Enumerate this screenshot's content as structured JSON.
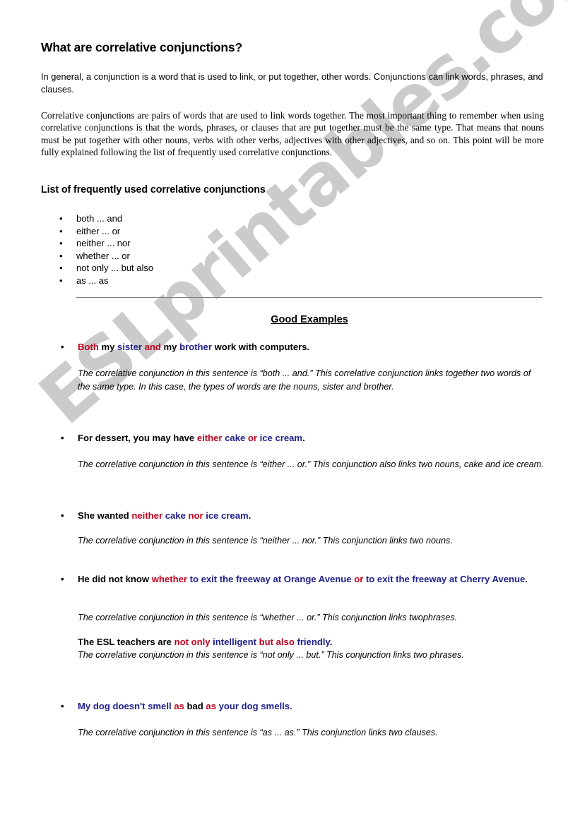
{
  "document": {
    "title": "What are correlative conjunctions?",
    "intro_paragraph": "In general, a conjunction is a word that is used to link, or put together, other words.  Conjunctions can link words, phrases, and clauses.",
    "definition_paragraph": "Correlative conjunctions are pairs of words that are used to link words together.  The most important thing to remember when using correlative conjunctions is that the words, phrases, or clauses that are put together must be the same type.  That means that nouns must be put together with other nouns, verbs with other verbs, adjectives with other adjectives, and so on.  This point will be more fully explained following the list of frequently used correlative conjunctions.",
    "list_heading": "List of frequently used correlative conjunctions",
    "conjunction_list": [
      "both ... and",
      "either ... or",
      "neither ... nor",
      "whether ... or",
      "not only ... but also",
      "as ... as"
    ],
    "examples_heading": "Good Examples",
    "bullet_glyph": "•",
    "examples": [
      {
        "sentence_parts": [
          {
            "text": "Both",
            "color": "red"
          },
          {
            "text": " my ",
            "color": "black"
          },
          {
            "text": "sister",
            "color": "blue"
          },
          {
            "text": " ",
            "color": "black"
          },
          {
            "text": "and",
            "color": "red"
          },
          {
            "text": " my ",
            "color": "black"
          },
          {
            "text": "brother",
            "color": "blue"
          },
          {
            "text": " work with computers.",
            "color": "black"
          }
        ],
        "explanation": "The correlative conjunction in this sentence is “both ... and.”  This correlative conjunction links together two words of the same type.  In this case, the types of words are the nouns, sister and brother."
      },
      {
        "sentence_parts": [
          {
            "text": "For dessert, you may have ",
            "color": "black"
          },
          {
            "text": "either",
            "color": "red"
          },
          {
            "text": " cake ",
            "color": "blue"
          },
          {
            "text": "or",
            "color": "red"
          },
          {
            "text": " ice cream",
            "color": "blue"
          },
          {
            "text": ".",
            "color": "black"
          }
        ],
        "explanation": "The correlative conjunction in this sentence is “either ... or.”  This conjunction also links two nouns, cake and ice cream."
      },
      {
        "sentence_parts": [
          {
            "text": "She wanted ",
            "color": "black"
          },
          {
            "text": "neither",
            "color": "red"
          },
          {
            "text": " cake ",
            "color": "blue"
          },
          {
            "text": "nor",
            "color": "red"
          },
          {
            "text": " ice cream",
            "color": "blue"
          },
          {
            "text": ".",
            "color": "black"
          }
        ],
        "explanation": "The correlative conjunction in this sentence is “neither ... nor.”  This conjunction links two nouns."
      },
      {
        "sentence_parts": [
          {
            "text": "He did not know ",
            "color": "black"
          },
          {
            "text": "whether",
            "color": "red"
          },
          {
            "text": " to exit the freeway at Orange Avenue ",
            "color": "blue"
          },
          {
            "text": "or",
            "color": "red"
          },
          {
            "text": " to exit the freeway at Cherry Avenue",
            "color": "blue"
          },
          {
            "text": ".",
            "color": "black"
          }
        ],
        "explanation": "The correlative conjunction in this sentence is “whether ... or.”  This conjunction links twophrases."
      },
      {
        "sentence_parts": [
          {
            "text": "The ESL teachers are ",
            "color": "black"
          },
          {
            "text": "not only",
            "color": "red"
          },
          {
            "text": " intelligent ",
            "color": "blue"
          },
          {
            "text": "but also",
            "color": "red"
          },
          {
            "text": " friendly",
            "color": "blue"
          },
          {
            "text": ".",
            "color": "black"
          }
        ],
        "explanation": "The correlative conjunction in this sentence is “not only ... but.”  This conjunction links two phrases."
      },
      {
        "sentence_parts": [
          {
            "text": "My dog doesn't smell ",
            "color": "blue"
          },
          {
            "text": "as",
            "color": "red"
          },
          {
            "text": " bad ",
            "color": "black"
          },
          {
            "text": "as",
            "color": "red"
          },
          {
            "text": " your dog smells.",
            "color": "blue"
          }
        ],
        "explanation": "The correlative conjunction in this sentence is “as ... as.”  This conjunction links two clauses."
      }
    ]
  },
  "watermark": {
    "text": "ESLprintables.com",
    "color": "#c9c9c9"
  },
  "colors": {
    "red": "#c00020",
    "blue": "#20208c",
    "black": "#000000",
    "divider": "#7d7d7d"
  }
}
